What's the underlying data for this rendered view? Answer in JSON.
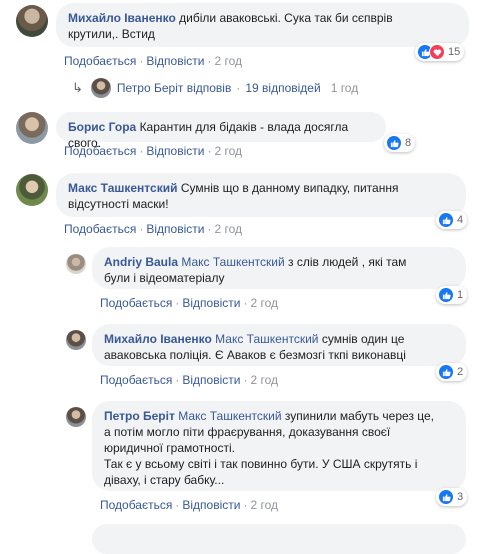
{
  "actions": {
    "like": "Подобається",
    "reply": "Відповісти",
    "sep": "·"
  },
  "comments": [
    {
      "author": "Михайло Іваненко",
      "text_line1": "дибіли аваковські. Сука так би сєпврів",
      "text_line2": "крутили,. Встид",
      "time": "2 год",
      "reactions": {
        "types": [
          "like-icon",
          "love-icon"
        ],
        "count": "15"
      }
    },
    {
      "author": "Борис Гора",
      "text": "Карантин для бідаків - влада досягла свого.",
      "time": "2 год",
      "reactions": {
        "types": [
          "like-icon"
        ],
        "count": "8"
      }
    },
    {
      "author": "Макс Ташкентский",
      "text_line1": "Сумнів що в данному випадку, питання",
      "text_line2": "відсутності маски!",
      "time": "2 год",
      "reactions": {
        "types": [
          "like-icon"
        ],
        "count": "4"
      }
    }
  ],
  "thread_summary": {
    "author": "Петро Беріт",
    "verb": "відповів",
    "sep": "·",
    "replies": "19 відповідей",
    "time": "1 год"
  },
  "replies": [
    {
      "author": "Andriy Baula",
      "mention": "Макс Ташкентский",
      "text_line1": "з слів людей , які там",
      "text_line2": "були і відеоматеріалу",
      "time": "2 год",
      "reactions": {
        "types": [
          "like-icon"
        ],
        "count": "1"
      }
    },
    {
      "author": "Михайло Іваненко",
      "mention": "Макс Ташкентский",
      "text_line1": "сумнів один це",
      "text_line2": "аваковська поліція. Є Аваков є безмозгі ткпі виконавці",
      "time": "2 год",
      "reactions": {
        "types": [
          "like-icon"
        ],
        "count": "2"
      }
    },
    {
      "author": "Петро Беріт",
      "mention": "Макс Ташкентский",
      "text_line1": "зупинили мабуть через це,",
      "text_line2": "а потім могло піти фраєрування, доказування своєї",
      "text_line3": "юридичної грамотності.",
      "text_line4": "Так є у всьому світі і так повинно бути. У США скрутять і",
      "text_line5": "діваху, і стару бабку...",
      "time": "2 год",
      "reactions": {
        "types": [
          "like-icon"
        ],
        "count": "3"
      }
    }
  ],
  "colors": {
    "link": "#385898",
    "bubble": "#f2f3f5",
    "like": "#1877f2",
    "love": "#f33e58",
    "meta": "#90949c"
  }
}
